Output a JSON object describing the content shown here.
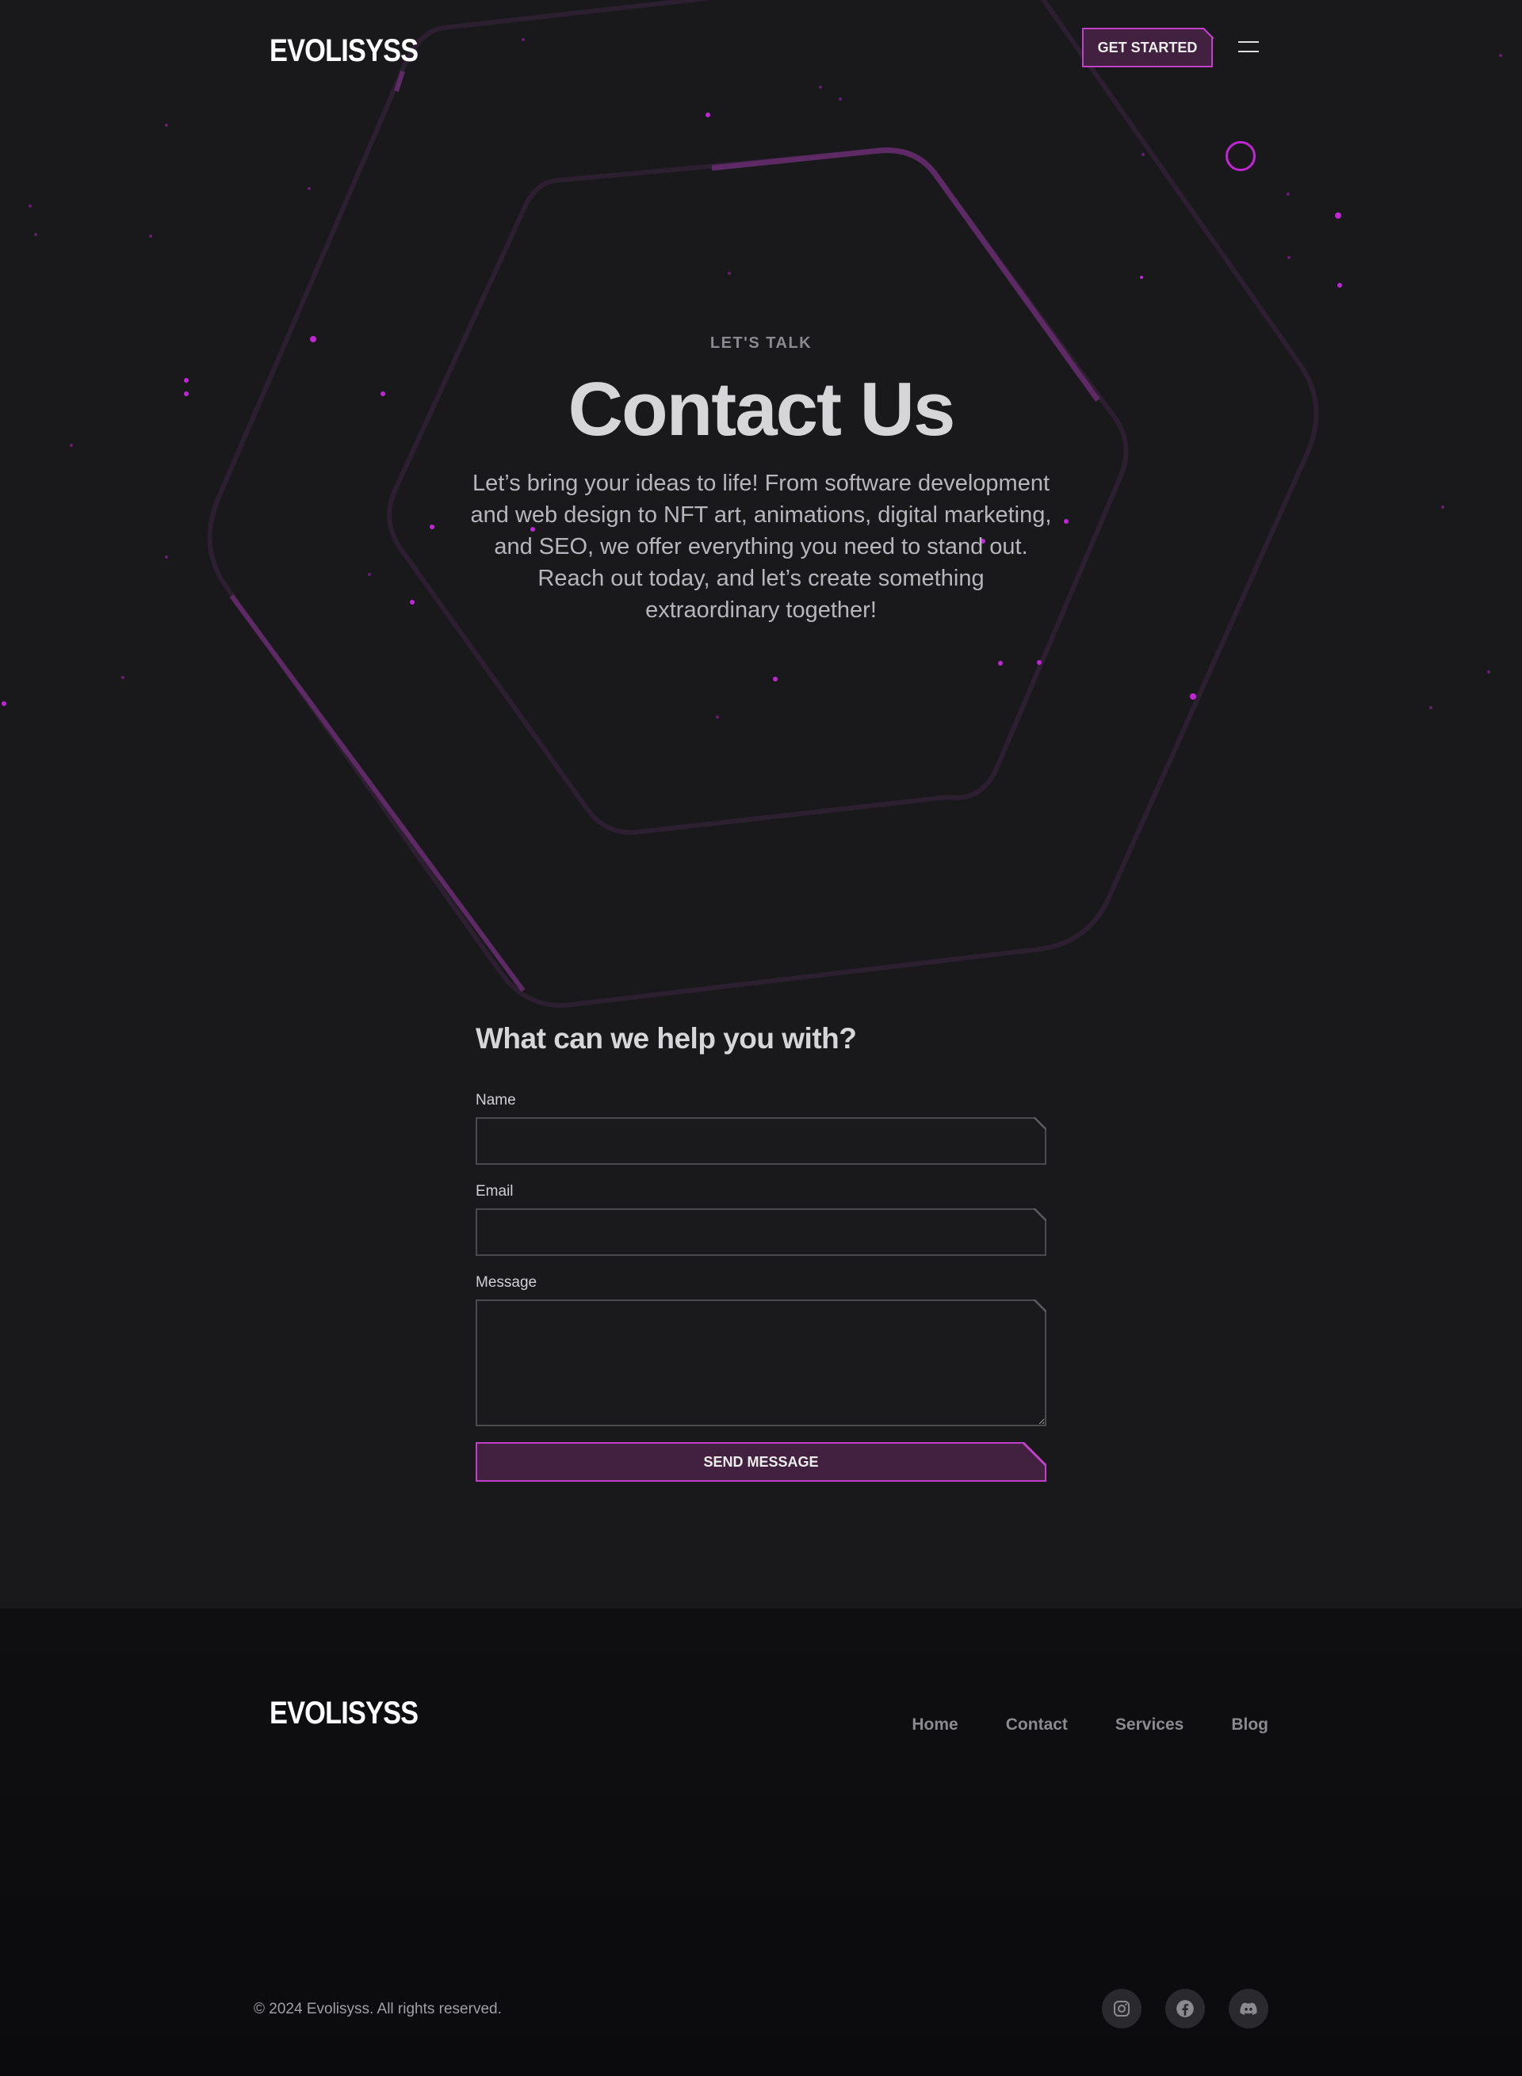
{
  "brand": {
    "name": "EVOLISYSS",
    "accent": "#c040c8",
    "background": "#19191c"
  },
  "header": {
    "cta_label": "GET STARTED",
    "menu_icon": "hamburger-icon"
  },
  "hero": {
    "eyebrow": "LET'S TALK",
    "title": "Contact Us",
    "intro_line1": "Let’s bring your ideas to life! From software development and web design to NFT art, animations, digital marketing, and SEO, we offer everything you need to stand out.",
    "intro_line2": "Reach out today, and let’s create something extraordinary together!"
  },
  "form": {
    "title": "What can we help you with?",
    "name_label": "Name",
    "name_value": "",
    "email_label": "Email",
    "email_value": "",
    "message_label": "Message",
    "message_value": "",
    "submit_label": "SEND MESSAGE"
  },
  "footer": {
    "nav": [
      {
        "label": "Home"
      },
      {
        "label": "Contact"
      },
      {
        "label": "Services"
      },
      {
        "label": "Blog"
      }
    ],
    "copyright": "© 2024 Evolisyss. All rights reserved.",
    "socials": [
      {
        "icon": "instagram-icon"
      },
      {
        "icon": "facebook-icon"
      },
      {
        "icon": "discord-icon"
      }
    ]
  }
}
